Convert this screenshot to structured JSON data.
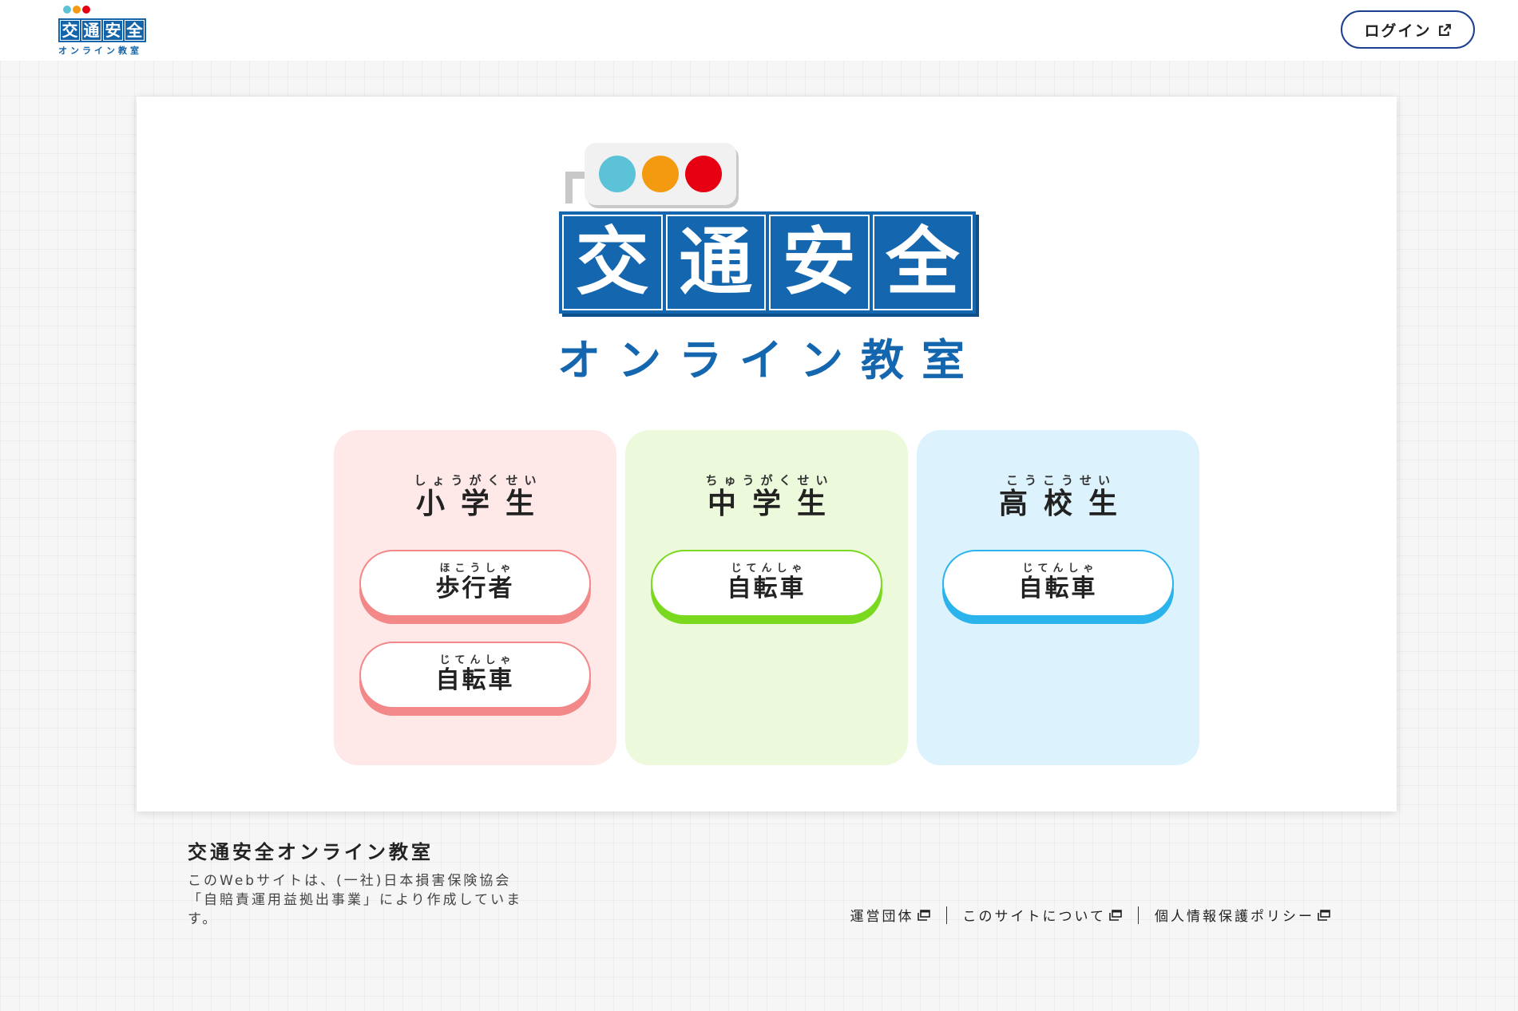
{
  "header": {
    "logo": {
      "title_chars": [
        "交",
        "通",
        "安",
        "全"
      ],
      "subtitle": "オンライン教室",
      "lights": [
        "#5bc2d8",
        "#f39a10",
        "#e60012"
      ]
    },
    "login_label": "ログイン",
    "login_icon": "external-link-icon"
  },
  "hero": {
    "title_chars": [
      "交",
      "通",
      "安",
      "全"
    ],
    "subtitle": "オンライン教室",
    "lights": [
      "#5bc2d8",
      "#f39a10",
      "#e60012"
    ]
  },
  "panels": [
    {
      "grade": "小学生",
      "grade_ruby": "しょうがくせい",
      "color": "#ffe8e8",
      "buttons": [
        {
          "label": "歩行者",
          "ruby": "ほこうしゃ"
        },
        {
          "label": "自転車",
          "ruby": "じてんしゃ"
        }
      ]
    },
    {
      "grade": "中学生",
      "grade_ruby": "ちゅうがくせい",
      "color": "#ecfadb",
      "buttons": [
        {
          "label": "自転車",
          "ruby": "じてんしゃ"
        }
      ]
    },
    {
      "grade": "高校生",
      "grade_ruby": "こうこうせい",
      "color": "#dcf2fd",
      "buttons": [
        {
          "label": "自転車",
          "ruby": "じてんしゃ"
        }
      ]
    }
  ],
  "footer": {
    "title": "交通安全オンライン教室",
    "description": "このWebサイトは、(一社)日本損害保険協会「自賠責運用益拠出事業」により作成しています。",
    "links": [
      {
        "label": "運営団体",
        "icon": "external-window-icon"
      },
      {
        "label": "このサイトについて",
        "icon": "external-window-icon"
      },
      {
        "label": "個人情報保護ポリシー",
        "icon": "external-window-icon"
      }
    ]
  }
}
